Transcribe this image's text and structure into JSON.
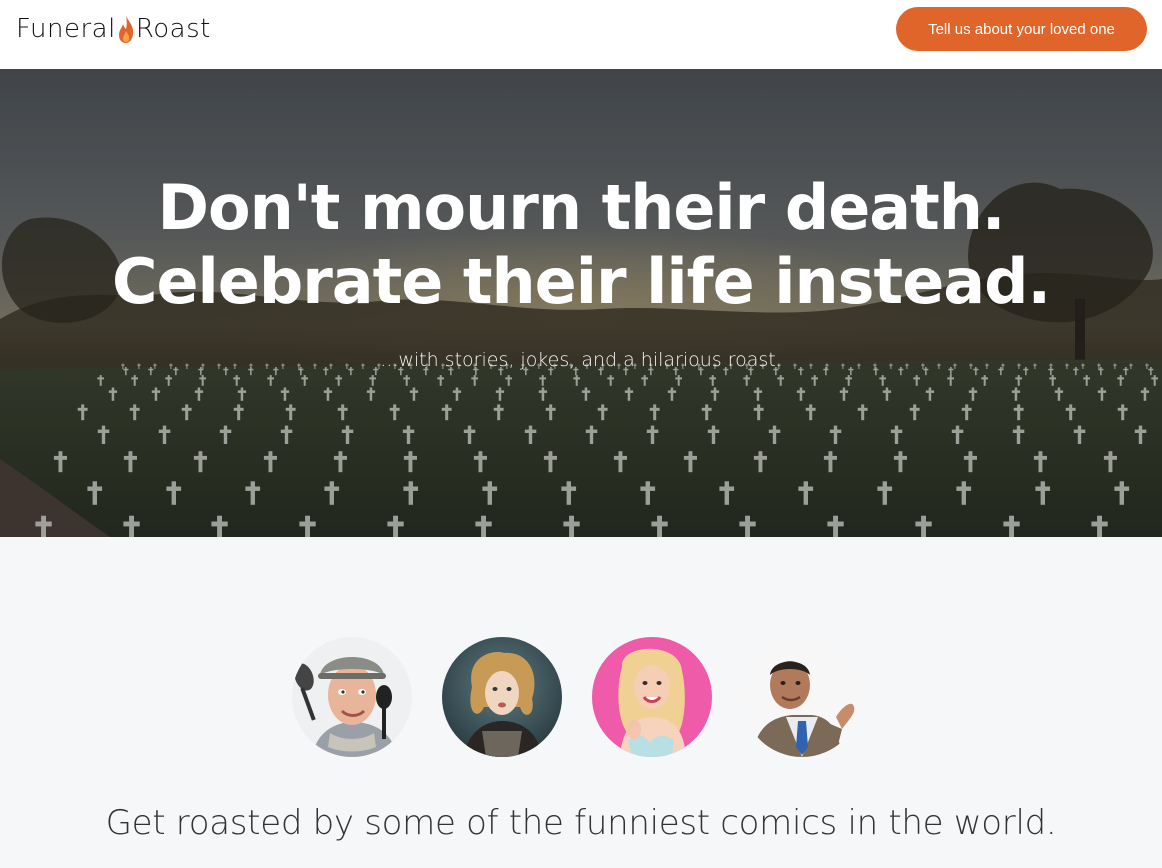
{
  "header": {
    "logo_left": "Funeral",
    "logo_right": "Roast",
    "logo_icon": "flame-icon",
    "cta_label": "Tell us about your loved one"
  },
  "hero": {
    "title_line1": "Don't mourn their death.",
    "title_line2": "Celebrate their life instead.",
    "subtitle": "...with stories, jokes, and a hilarious roast."
  },
  "comics": {
    "tagline": "Get roasted by some of the funniest comics in the world.",
    "avatars": [
      {
        "icon": "comic-chef-avatar"
      },
      {
        "icon": "comic-vintage-woman-avatar"
      },
      {
        "icon": "comic-pink-woman-avatar"
      },
      {
        "icon": "comic-suit-man-avatar"
      }
    ]
  },
  "colors": {
    "accent": "#e0652b",
    "section_bg": "#f6f7f9",
    "header_bg": "#ffffff"
  }
}
